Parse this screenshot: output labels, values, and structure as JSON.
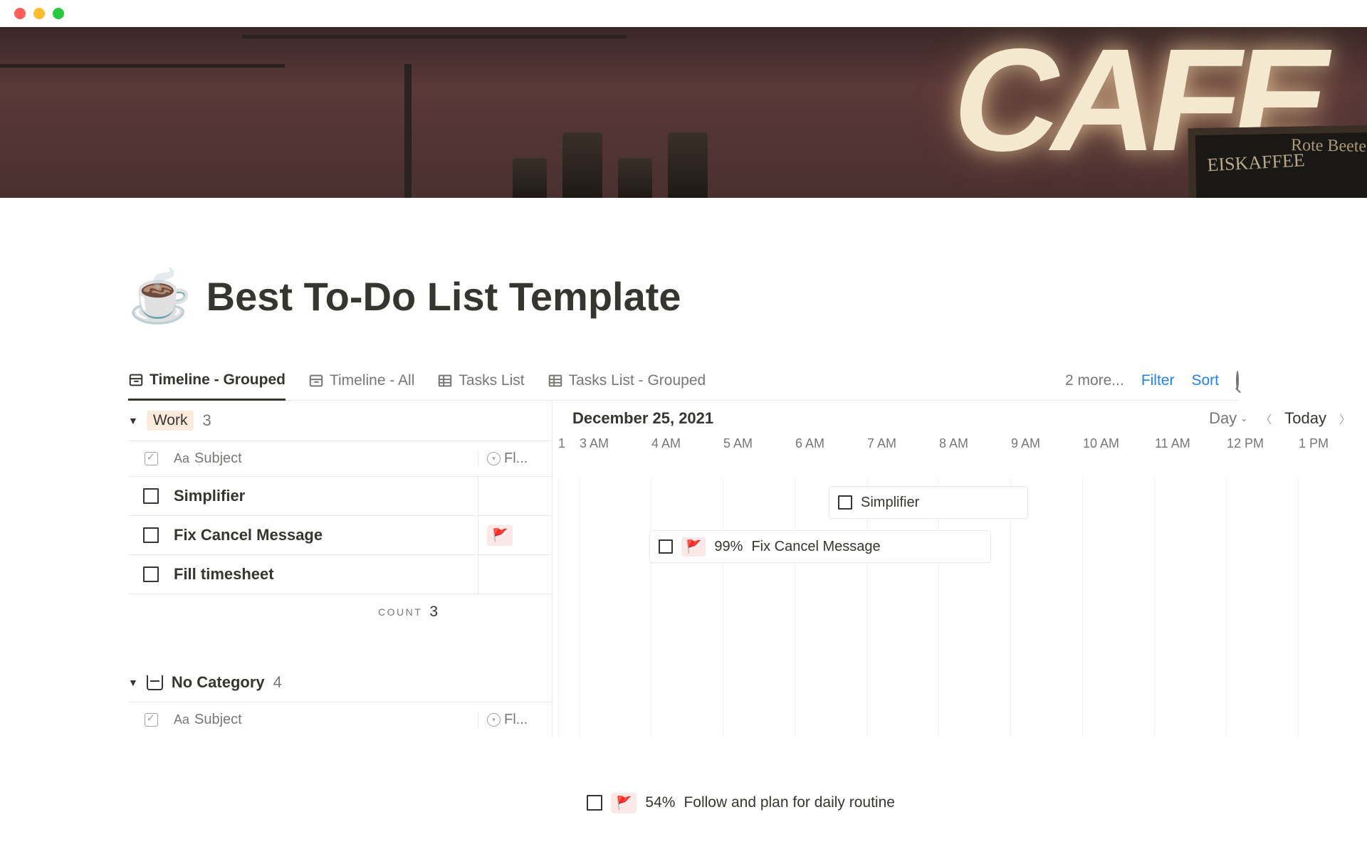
{
  "page": {
    "emoji": "☕",
    "title": "Best To-Do List Template"
  },
  "cover": {
    "sign": "CAFE",
    "board1": "EISKAFFEE",
    "board2": "Rote  Beete"
  },
  "views": {
    "tabs": [
      {
        "label": "Timeline - Grouped",
        "icon": "timeline",
        "active": true
      },
      {
        "label": "Timeline - All",
        "icon": "timeline",
        "active": false
      },
      {
        "label": "Tasks List",
        "icon": "table",
        "active": false
      },
      {
        "label": "Tasks List - Grouped",
        "icon": "table",
        "active": false
      }
    ],
    "more": "2 more...",
    "filter": "Filter",
    "sort": "Sort"
  },
  "timeline": {
    "date": "December 25, 2021",
    "scale": "Day",
    "today": "Today",
    "hours": [
      "1",
      "3 AM",
      "4 AM",
      "5 AM",
      "6 AM",
      "7 AM",
      "8 AM",
      "9 AM",
      "10 AM",
      "11 AM",
      "12 PM",
      "1 PM"
    ]
  },
  "columns": {
    "subject": "Subject",
    "flag": "Fl..."
  },
  "groups": [
    {
      "name": "Work",
      "count": "3",
      "tasks": [
        {
          "name": "Simplifier",
          "flagged": false
        },
        {
          "name": "Fix Cancel Message",
          "flagged": true
        },
        {
          "name": "Fill timesheet",
          "flagged": false
        }
      ],
      "count_label": "COUNT",
      "count_value": "3"
    },
    {
      "name": "No Category",
      "count": "4"
    }
  ],
  "events": [
    {
      "name": "Simplifier",
      "flagged": false,
      "percent": null
    },
    {
      "name": "Fix Cancel Message",
      "flagged": true,
      "percent": "99%"
    }
  ],
  "bottom_event": {
    "percent": "54%",
    "name": "Follow and plan for daily routine"
  }
}
